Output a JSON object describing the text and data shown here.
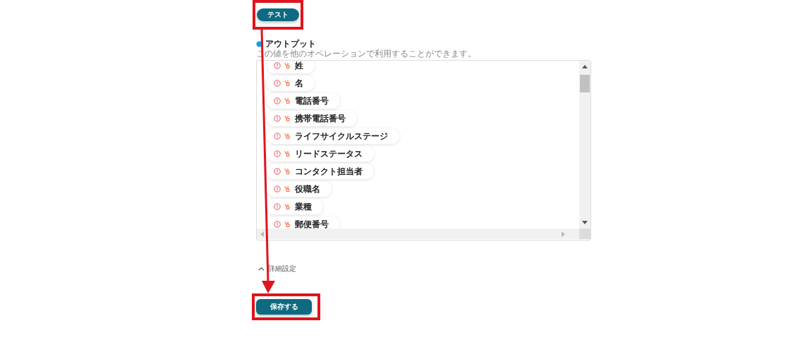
{
  "test_button": {
    "label": "テスト"
  },
  "output": {
    "title": "アウトプット",
    "description": "この値を他のオペレーションで利用することができます。",
    "items": [
      {
        "label": "姓"
      },
      {
        "label": "名"
      },
      {
        "label": "電話番号"
      },
      {
        "label": "携帯電話番号"
      },
      {
        "label": "ライフサイクルステージ"
      },
      {
        "label": "リードステータス"
      },
      {
        "label": "コンタクト担当者"
      },
      {
        "label": "役職名"
      },
      {
        "label": "業種"
      },
      {
        "label": "郵便番号"
      }
    ]
  },
  "advanced": {
    "label": "詳細設定",
    "expanded": true
  },
  "save_button": {
    "label": "保存する"
  }
}
